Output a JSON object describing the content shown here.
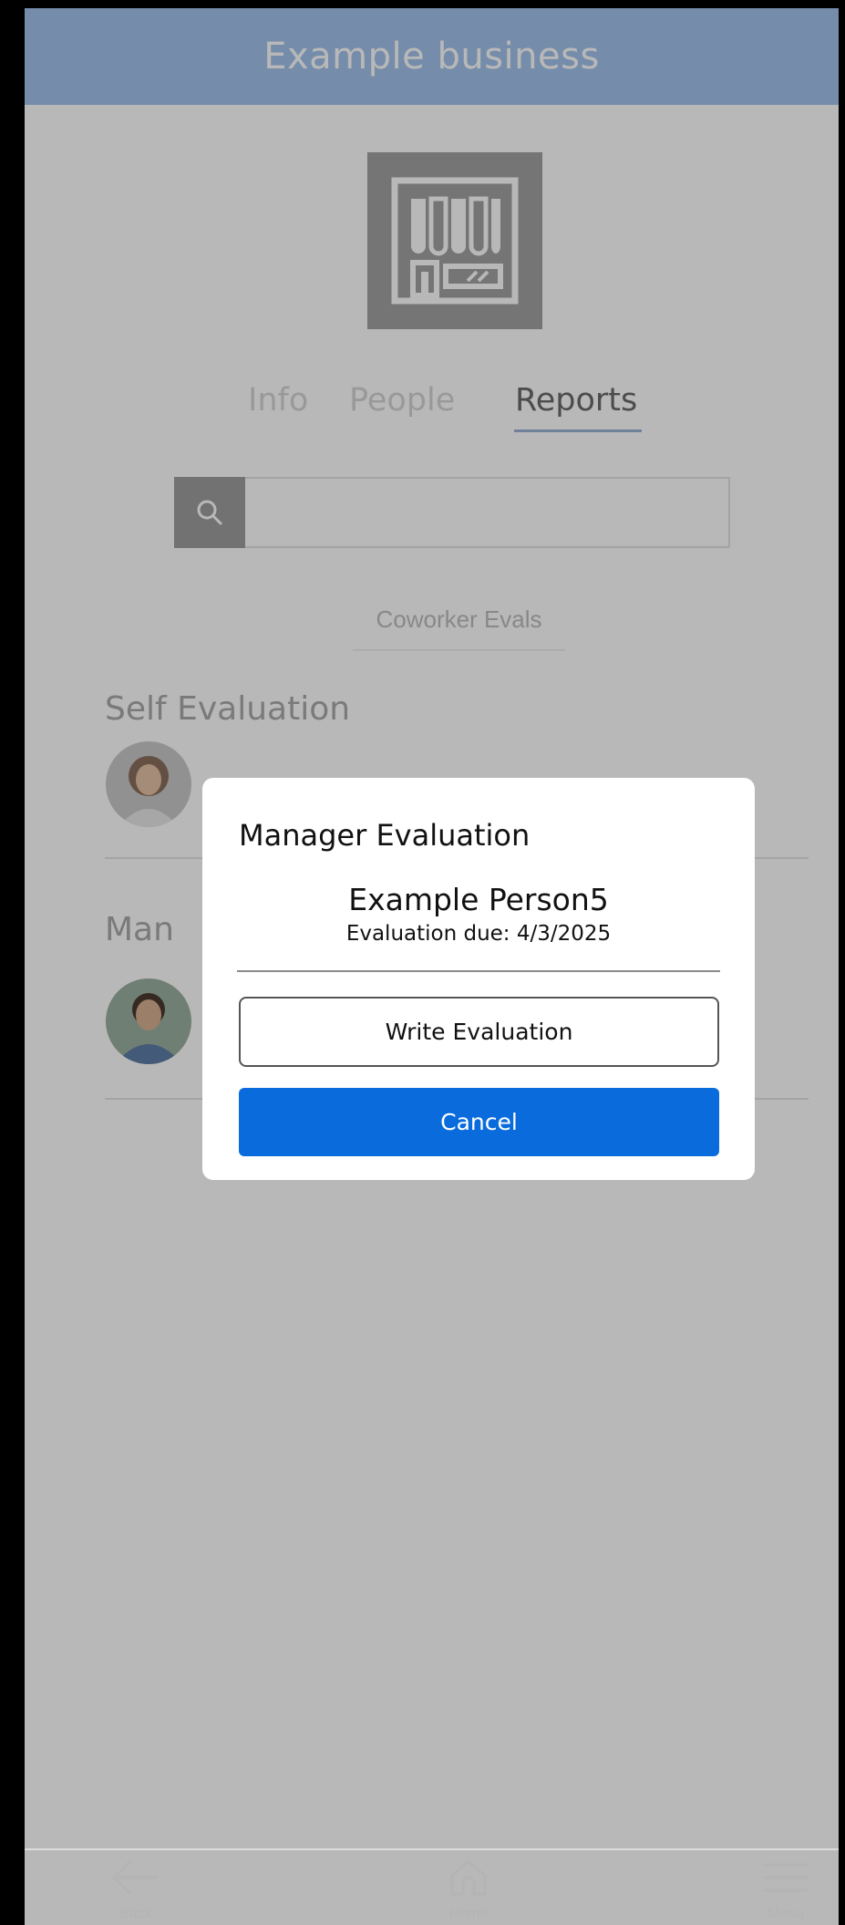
{
  "header": {
    "title": "Example business"
  },
  "tabs": [
    {
      "label": "Info"
    },
    {
      "label": "People"
    },
    {
      "label": "Reports"
    }
  ],
  "active_tab": "Reports",
  "search": {
    "value": ""
  },
  "filters": {
    "chip": "Coworker Evals"
  },
  "sections": {
    "self": {
      "heading": "Self Evaluation"
    },
    "manager": {
      "heading": "Man"
    }
  },
  "modal": {
    "title": "Manager Evaluation",
    "person": "Example Person5",
    "due": "Evaluation due: 4/3/2025",
    "write_label": "Write Evaluation",
    "cancel_label": "Cancel"
  },
  "bottom_nav": {
    "back": "Back",
    "home": "Home",
    "menu": "Menu"
  },
  "colors": {
    "header_bg": "#a3c4ec",
    "primary_button": "#0a6cdc",
    "overlay": "rgba(0,0,0,0.28)"
  },
  "icons": {
    "search": "magnifier-icon",
    "logo": "storefront-icon",
    "back": "arrow-left-icon",
    "home": "home-icon",
    "menu": "hamburger-icon"
  }
}
